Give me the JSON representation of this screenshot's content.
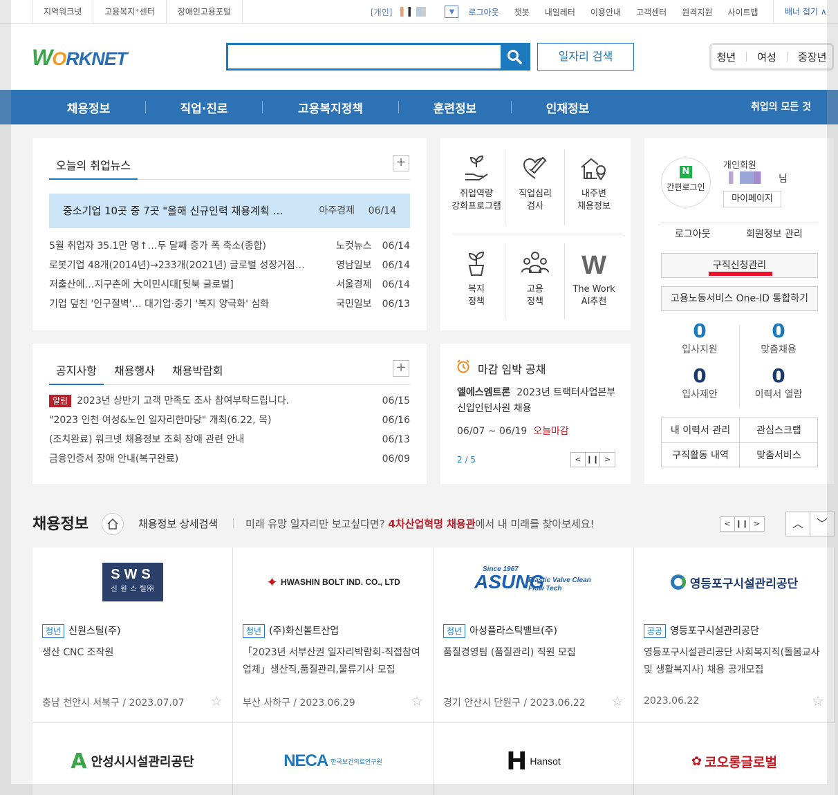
{
  "util": {
    "left_links": [
      "지역워크넷",
      "고용복지⁺센터",
      "장애인고용포털"
    ],
    "member_tag": "[개인]",
    "right_links": [
      "로그아웃",
      "챗봇",
      "내일레터",
      "이용안내",
      "고객센터",
      "원격지원",
      "사이트맵"
    ],
    "banner_fold": "배너 접기"
  },
  "header": {
    "logo": "WORKNET",
    "search_placeholder": "",
    "job_search_label": "일자리 검색",
    "age_links": [
      "청년",
      "여성",
      "중장년"
    ]
  },
  "gnb": {
    "items": [
      "채용정보",
      "직업·진로",
      "고용복지정책",
      "훈련정보",
      "인재정보"
    ],
    "all_label": "취업의 모든 것"
  },
  "news": {
    "tab": "오늘의 취업뉴스",
    "plus": "+",
    "headline": {
      "title": "중소기업 10곳 중 7곳 \"올해 신규인력 채용계획 …",
      "source": "아주경제",
      "date": "06/14"
    },
    "items": [
      {
        "title": "5월 취업자 35.1만 명↑…두 달째 증가 폭 축소(종합)",
        "source": "노컷뉴스",
        "date": "06/14"
      },
      {
        "title": "로봇기업 48개(2014년)→233개(2021년) 글로벌 성장거점…",
        "source": "영남일보",
        "date": "06/14"
      },
      {
        "title": "저출산에…지구촌에 大이민시대[뒷북 글로벌]",
        "source": "서울경제",
        "date": "06/14"
      },
      {
        "title": "기업 덮친 '인구절벽'… 대기업·중기 '복지 양극화' 심화",
        "source": "국민일보",
        "date": "06/13"
      }
    ]
  },
  "services": [
    {
      "label1": "취업역량",
      "label2": "강화프로그램",
      "icon": "plant-hand-icon"
    },
    {
      "label1": "직업심리",
      "label2": "검사",
      "icon": "heart-pencil-icon"
    },
    {
      "label1": "내주변",
      "label2": "채용정보",
      "icon": "house-pin-icon"
    },
    {
      "label1": "복지",
      "label2": "정책",
      "icon": "potted-plant-icon"
    },
    {
      "label1": "고용",
      "label2": "정책",
      "icon": "people-group-icon"
    },
    {
      "label1": "The Work",
      "label2": "AI추천",
      "icon": "w-logo-icon"
    }
  ],
  "notice": {
    "tabs": [
      "공지사항",
      "채용행사",
      "채용박람회"
    ],
    "plus": "+",
    "badge": "알림",
    "items": [
      {
        "title": "2023년 상반기 고객 만족도 조사 참여부탁드립니다.",
        "date": "06/15"
      },
      {
        "title": "\"2023 인천 여성&노인 일자리한마당\" 개최(6.22, 목)",
        "date": "06/16"
      },
      {
        "title": "(조치완료) 워크넷 채용정보 조회 장애 관련 안내",
        "date": "06/13"
      },
      {
        "title": "금융인증서 장애 안내(복구완료)",
        "date": "06/09"
      }
    ]
  },
  "deadline": {
    "title": "마감 임박 공채",
    "company": "엘에스엠트론",
    "desc": "2023년 트랙터사업본부 신입인턴사원 채용",
    "period": "06/07 ~ 06/19",
    "today": "오늘마감",
    "page": "2 / 5"
  },
  "user": {
    "naver_letter": "N",
    "simple_login": "간편로그인",
    "member_type": "개인회원",
    "name_suffix": "님",
    "mypage": "마이페이지",
    "logout": "로그아웃",
    "member_info": "회원정보 관리",
    "job_request": "구직신청관리",
    "oneid": "고용노동서비스 One-ID 통합하기",
    "stats": [
      {
        "value": "0",
        "label": "입사지원"
      },
      {
        "value": "0",
        "label": "맞춤채용"
      },
      {
        "value": "0",
        "label": "입사제안"
      },
      {
        "value": "0",
        "label": "이력서 열람"
      }
    ],
    "links": [
      "내 이력서 관리",
      "관심스크랩",
      "구직활동 내역",
      "맞춤서비스"
    ]
  },
  "jobs": {
    "title": "채용정보",
    "detail_search": "채용정보 상세검색",
    "promo_pre": "미래 유망 일자리만 보고싶다면?",
    "promo_bold": "4차산업혁명 채용관",
    "promo_post": "에서 내 미래를 찾아보세요!",
    "cards": [
      {
        "logo": "SWS",
        "logo_sub": "신 원 스 틸㈜",
        "category": "청년",
        "company": "신원스틸(주)",
        "desc": "생산 CNC 조작원",
        "loc": "충남 천안시 서북구 / 2023.07.07"
      },
      {
        "logo": "HWASHIN BOLT IND. CO., LTD",
        "category": "청년",
        "company": "(주)화신볼트산업",
        "desc": "「2023년 서부산권 일자리박람회-직접참여업체」생산직,품질관리,물류기사 모집",
        "loc": "부산 사하구 / 2023.06.29"
      },
      {
        "logo": "ASUNG",
        "logo_since": "Since 1967",
        "logo_sub": "Plastic Valve Clean Flow Tech",
        "category": "청년",
        "company": "아성플라스틱밸브(주)",
        "desc": "품질경영팀 (품질관리) 직원 모집",
        "loc": "경기 안산시 단원구 / 2023.06.22"
      },
      {
        "logo": "영등포구시설관리공단",
        "category": "공공",
        "company": "영등포구시설관리공단",
        "desc": "영등포구시설관리공단 사회복지직(돌봄교사 및 생활복지사) 채용 공개모집",
        "loc": "2023.06.22"
      }
    ],
    "row2_logos": [
      "안성시시설관리공단",
      "NECA",
      "한국보건의료연구원",
      "Hansot",
      "코오롱글로벌"
    ]
  }
}
